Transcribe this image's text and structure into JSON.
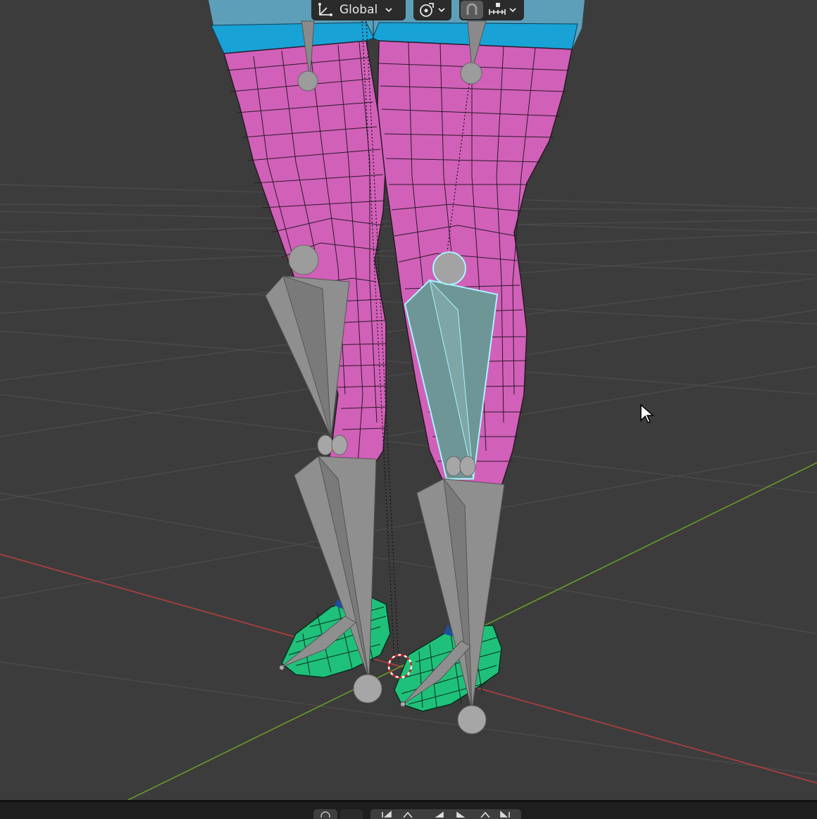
{
  "header": {
    "transform_orientation": {
      "label": "Global",
      "icon": "orientation-axes-icon"
    },
    "pivot_icon": "pivot-point-icon",
    "snap_icon": "snap-magnet-icon",
    "snap_target_icon": "snap-increment-icon"
  },
  "viewport": {
    "grid_color": "#4a4a4a",
    "x_axis_color": "#b33f3f",
    "y_axis_color": "#6b9a2a",
    "leg_mesh_color": "#d160b8",
    "shorts_color": "#1ea3d6",
    "shoe_mesh_color": "#1fc17a",
    "bone_color": "#8f8f8f",
    "selected_bone_color": "#6e9696",
    "selected_outline_color": "#a8f4ff"
  },
  "timeline": {
    "playback_buttons": [
      "jump-start-icon",
      "prev-keyframe-icon",
      "play-reverse-icon",
      "play-icon",
      "next-keyframe-icon",
      "jump-end-icon"
    ]
  }
}
